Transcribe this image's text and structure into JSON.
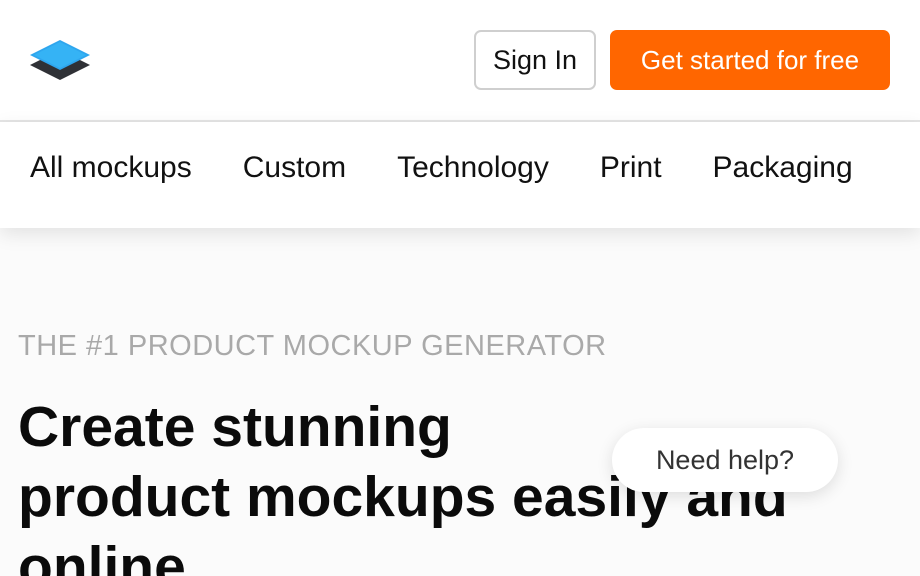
{
  "header": {
    "logo_icon": "layers-logo-icon",
    "signin_label": "Sign In",
    "cta_label": "Get started for free",
    "cta_color": "#ff6600"
  },
  "categories": [
    "All mockups",
    "Custom",
    "Technology",
    "Print",
    "Packaging"
  ],
  "hero": {
    "eyebrow": "THE #1 PRODUCT MOCKUP GENERATOR",
    "headline_line1": "Create stunning",
    "headline_line2": "product mockups easily and",
    "headline_line3": "online"
  },
  "help": {
    "label": "Need help?"
  }
}
